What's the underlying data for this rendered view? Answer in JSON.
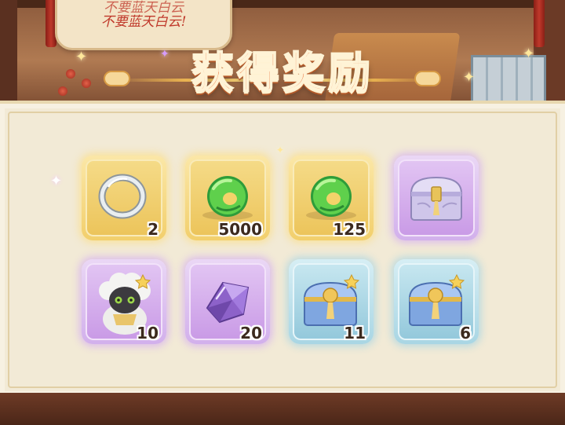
{
  "background": {
    "speech_line1": "不要蓝天白云",
    "speech_line2": "不要蓝天白云!"
  },
  "title": "获得奖励",
  "colors": {
    "title": "#e8703a",
    "gold_slot": "#f2cf6c",
    "purple_slot": "#d2b0ec",
    "blue_slot": "#a9d6e4"
  },
  "rewards": [
    {
      "icon": "silver-ring-icon",
      "quantity": "2",
      "rarity": "gold"
    },
    {
      "icon": "green-jade-icon",
      "quantity": "5000",
      "rarity": "gold"
    },
    {
      "icon": "green-jade-icon",
      "quantity": "125",
      "rarity": "gold"
    },
    {
      "icon": "purple-chest-icon",
      "quantity": "",
      "rarity": "purple"
    },
    {
      "icon": "sheep-pet-icon",
      "quantity": "10",
      "rarity": "purple"
    },
    {
      "icon": "purple-crystal-icon",
      "quantity": "20",
      "rarity": "purple"
    },
    {
      "icon": "blue-chest-icon",
      "quantity": "11",
      "rarity": "blue"
    },
    {
      "icon": "blue-chest-icon",
      "quantity": "6",
      "rarity": "blue"
    }
  ]
}
